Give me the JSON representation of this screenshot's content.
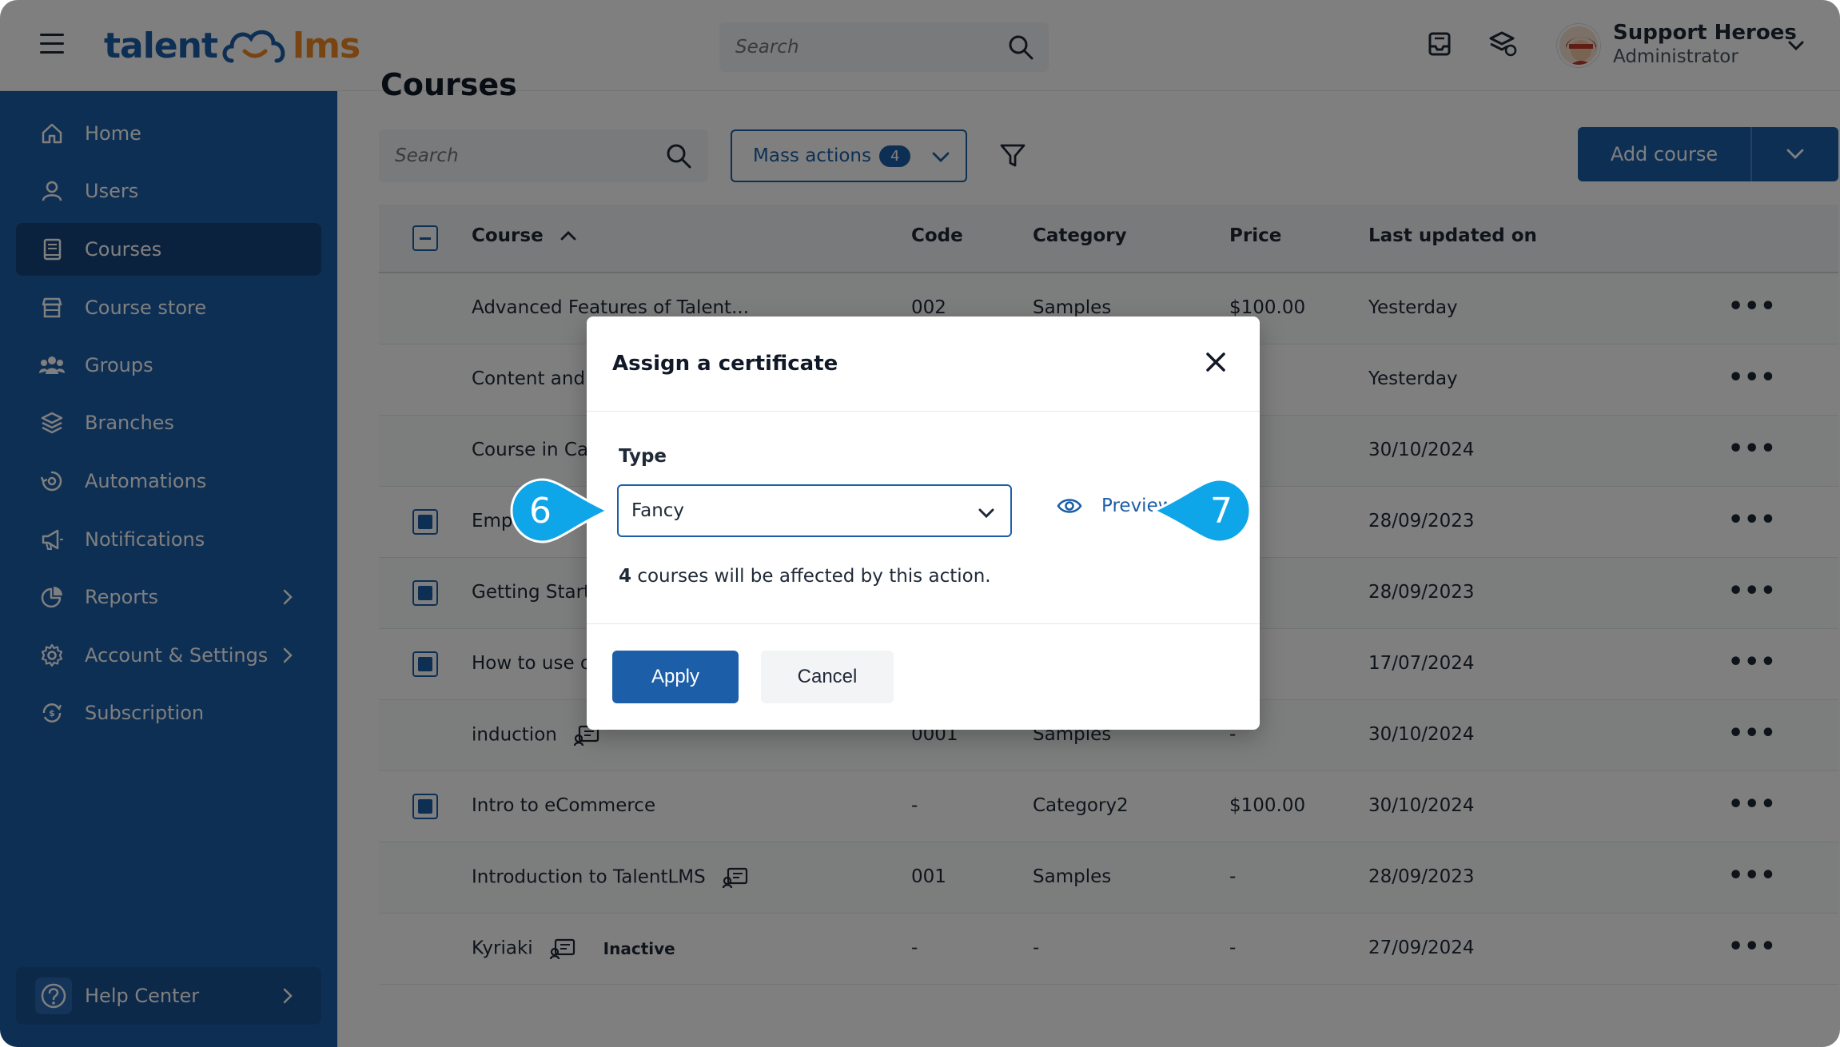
{
  "header": {
    "logo_left": "talent",
    "logo_right": "lms",
    "search_placeholder": "Search",
    "user_name": "Support Heroes",
    "user_role": "Administrator"
  },
  "sidebar": {
    "items": [
      {
        "label": "Home",
        "icon": "home-icon"
      },
      {
        "label": "Users",
        "icon": "user-icon"
      },
      {
        "label": "Courses",
        "icon": "book-icon",
        "active": true
      },
      {
        "label": "Course store",
        "icon": "store-icon"
      },
      {
        "label": "Groups",
        "icon": "groups-icon"
      },
      {
        "label": "Branches",
        "icon": "layers-icon"
      },
      {
        "label": "Automations",
        "icon": "automation-icon"
      },
      {
        "label": "Notifications",
        "icon": "megaphone-icon"
      },
      {
        "label": "Reports",
        "icon": "pie-chart-icon",
        "has_submenu": true
      },
      {
        "label": "Account & Settings",
        "icon": "gear-icon",
        "has_submenu": true
      },
      {
        "label": "Subscription",
        "icon": "subscription-icon"
      }
    ],
    "help_label": "Help Center"
  },
  "main": {
    "page_title": "Courses",
    "search_placeholder": "Search",
    "mass_actions_label": "Mass actions",
    "mass_actions_count": "4",
    "add_course_label": "Add course",
    "table": {
      "headers": {
        "course": "Course",
        "code": "Code",
        "category": "Category",
        "price": "Price",
        "updated": "Last updated on"
      },
      "rows": [
        {
          "name": "Advanced Features of Talent...",
          "code": "002",
          "category": "Samples",
          "price": "$100.00",
          "updated": "Yesterday",
          "checked": false
        },
        {
          "name": "Content and T",
          "code": "",
          "category": "",
          "price": "",
          "updated": "Yesterday",
          "checked": false
        },
        {
          "name": "Course in Cat",
          "code": "",
          "category": "",
          "price": "",
          "updated": "30/10/2024",
          "checked": false
        },
        {
          "name": "Empl",
          "code": "",
          "category": "",
          "price": "",
          "updated": "28/09/2023",
          "checked": true
        },
        {
          "name": "Getting Starte",
          "code": "",
          "category": "",
          "price": "",
          "updated": "28/09/2023",
          "checked": true
        },
        {
          "name": "How to use o",
          "code": "",
          "category": "",
          "price": "",
          "updated": "17/07/2024",
          "checked": true
        },
        {
          "name": "induction",
          "code": "0001",
          "category": "Samples",
          "price": "-",
          "updated": "30/10/2024",
          "checked": false,
          "icon": true
        },
        {
          "name": "Intro to eCommerce",
          "code": "-",
          "category": "Category2",
          "price": "$100.00",
          "updated": "30/10/2024",
          "checked": true
        },
        {
          "name": "Introduction to TalentLMS",
          "code": "001",
          "category": "Samples",
          "price": "-",
          "updated": "28/09/2023",
          "checked": false,
          "icon": true
        },
        {
          "name": "Kyriaki",
          "code": "-",
          "category": "-",
          "price": "-",
          "updated": "27/09/2024",
          "checked": false,
          "icon": true,
          "status": "Inactive"
        }
      ]
    }
  },
  "modal": {
    "title": "Assign a certificate",
    "type_label": "Type",
    "type_value": "Fancy",
    "preview_label": "Preview",
    "affected_count": "4",
    "affected_text": "courses will be affected by this action.",
    "apply_label": "Apply",
    "cancel_label": "Cancel"
  },
  "callouts": {
    "step_a": "6",
    "step_b": "7",
    "color": "#0ea5e9"
  },
  "colors": {
    "brand_blue": "#1c5ea8",
    "logo_orange": "#f08a24"
  }
}
